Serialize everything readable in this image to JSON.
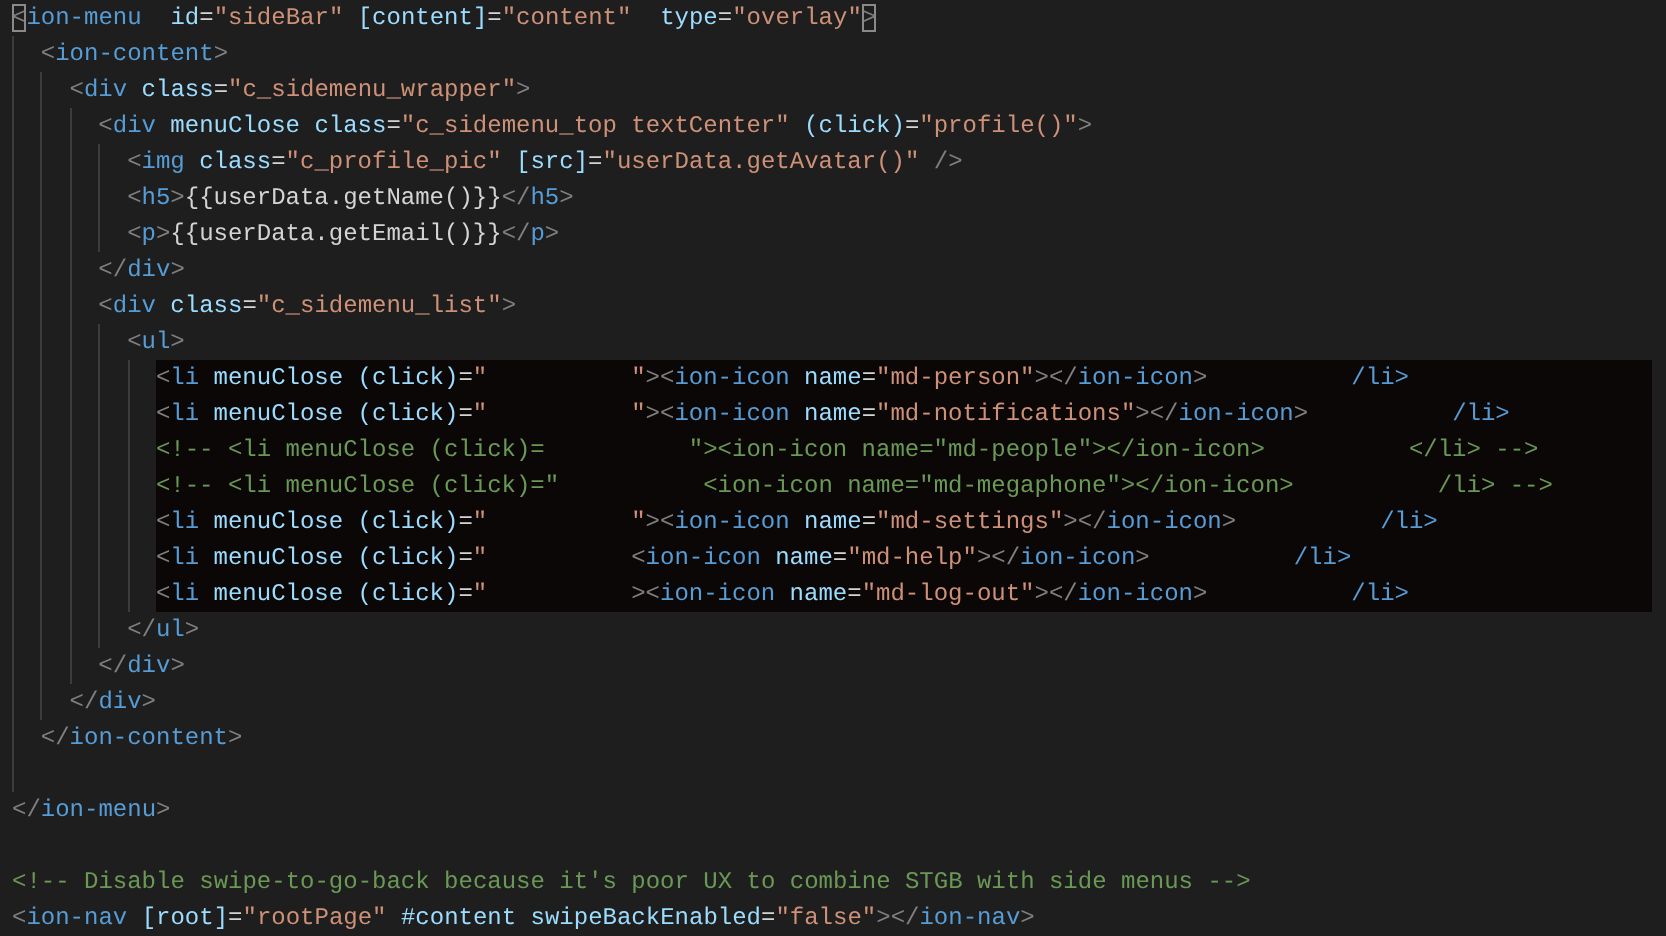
{
  "editor": {
    "lines": [
      {
        "segments": [
          {
            "kind": "match",
            "text": "<"
          },
          {
            "kind": "tag",
            "text": "ion-menu"
          },
          {
            "kind": "attr",
            "text": "  id"
          },
          {
            "kind": "op",
            "text": "="
          },
          {
            "kind": "str",
            "text": "\"sideBar\""
          },
          {
            "kind": "attr",
            "text": " [content]"
          },
          {
            "kind": "op",
            "text": "="
          },
          {
            "kind": "str",
            "text": "\"content\""
          },
          {
            "kind": "attr",
            "text": "  type"
          },
          {
            "kind": "op",
            "text": "="
          },
          {
            "kind": "str",
            "text": "\"overlay\""
          },
          {
            "kind": "match",
            "text": ">"
          }
        ],
        "children": [
          {
            "segments": [
              {
                "kind": "punct",
                "text": "<"
              },
              {
                "kind": "tag",
                "text": "ion-content"
              },
              {
                "kind": "punct",
                "text": ">"
              }
            ],
            "children": [
              {
                "segments": [
                  {
                    "kind": "punct",
                    "text": "<"
                  },
                  {
                    "kind": "tag",
                    "text": "div"
                  },
                  {
                    "kind": "attr",
                    "text": " class"
                  },
                  {
                    "kind": "op",
                    "text": "="
                  },
                  {
                    "kind": "str",
                    "text": "\"c_sidemenu_wrapper\""
                  },
                  {
                    "kind": "punct",
                    "text": ">"
                  }
                ],
                "children": [
                  {
                    "segments": [
                      {
                        "kind": "punct",
                        "text": "<"
                      },
                      {
                        "kind": "tag",
                        "text": "div"
                      },
                      {
                        "kind": "attr",
                        "text": " menuClose class"
                      },
                      {
                        "kind": "op",
                        "text": "="
                      },
                      {
                        "kind": "str",
                        "text": "\"c_sidemenu_top textCenter\""
                      },
                      {
                        "kind": "attr",
                        "text": " (click)"
                      },
                      {
                        "kind": "op",
                        "text": "="
                      },
                      {
                        "kind": "str",
                        "text": "\"profile()\""
                      },
                      {
                        "kind": "punct",
                        "text": ">"
                      }
                    ],
                    "children": [
                      {
                        "segments": [
                          {
                            "kind": "punct",
                            "text": "<"
                          },
                          {
                            "kind": "tag",
                            "text": "img"
                          },
                          {
                            "kind": "attr",
                            "text": " class"
                          },
                          {
                            "kind": "op",
                            "text": "="
                          },
                          {
                            "kind": "str",
                            "text": "\"c_profile_pic\""
                          },
                          {
                            "kind": "attr",
                            "text": " [src]"
                          },
                          {
                            "kind": "op",
                            "text": "="
                          },
                          {
                            "kind": "str",
                            "text": "\"userData.getAvatar()\""
                          },
                          {
                            "kind": "punct",
                            "text": " />"
                          }
                        ]
                      },
                      {
                        "segments": [
                          {
                            "kind": "punct",
                            "text": "<"
                          },
                          {
                            "kind": "tag",
                            "text": "h5"
                          },
                          {
                            "kind": "punct",
                            "text": ">"
                          },
                          {
                            "kind": "op",
                            "text": "{{userData.getName()}}"
                          },
                          {
                            "kind": "punct",
                            "text": "</"
                          },
                          {
                            "kind": "tag",
                            "text": "h5"
                          },
                          {
                            "kind": "punct",
                            "text": ">"
                          }
                        ]
                      },
                      {
                        "segments": [
                          {
                            "kind": "punct",
                            "text": "<"
                          },
                          {
                            "kind": "tag",
                            "text": "p"
                          },
                          {
                            "kind": "punct",
                            "text": ">"
                          },
                          {
                            "kind": "op",
                            "text": "{{userData.getEmail()}}"
                          },
                          {
                            "kind": "punct",
                            "text": "</"
                          },
                          {
                            "kind": "tag",
                            "text": "p"
                          },
                          {
                            "kind": "punct",
                            "text": ">"
                          }
                        ]
                      }
                    ]
                  },
                  {
                    "segments": [
                      {
                        "kind": "punct",
                        "text": "</"
                      },
                      {
                        "kind": "tag",
                        "text": "div"
                      },
                      {
                        "kind": "punct",
                        "text": ">"
                      }
                    ]
                  },
                  {
                    "segments": [
                      {
                        "kind": "punct",
                        "text": "<"
                      },
                      {
                        "kind": "tag",
                        "text": "div"
                      },
                      {
                        "kind": "attr",
                        "text": " class"
                      },
                      {
                        "kind": "op",
                        "text": "="
                      },
                      {
                        "kind": "str",
                        "text": "\"c_sidemenu_list\""
                      },
                      {
                        "kind": "punct",
                        "text": ">"
                      }
                    ],
                    "children": [
                      {
                        "segments": [
                          {
                            "kind": "punct",
                            "text": "<"
                          },
                          {
                            "kind": "tag",
                            "text": "ul"
                          },
                          {
                            "kind": "punct",
                            "text": ">"
                          }
                        ],
                        "children": [
                          {
                            "highlighted": true,
                            "segments": [
                              {
                                "kind": "punct",
                                "text": "<"
                              },
                              {
                                "kind": "tag",
                                "text": "li"
                              },
                              {
                                "kind": "attr",
                                "text": " menuClose (click)"
                              },
                              {
                                "kind": "op",
                                "text": "="
                              },
                              {
                                "kind": "str",
                                "text": "\""
                              },
                              {
                                "kind": "redacted"
                              },
                              {
                                "kind": "str",
                                "text": "\""
                              },
                              {
                                "kind": "punct",
                                "text": "><"
                              },
                              {
                                "kind": "tag",
                                "text": "ion-icon"
                              },
                              {
                                "kind": "attr",
                                "text": " name"
                              },
                              {
                                "kind": "op",
                                "text": "="
                              },
                              {
                                "kind": "str",
                                "text": "\"md-person\""
                              },
                              {
                                "kind": "punct",
                                "text": "></"
                              },
                              {
                                "kind": "tag",
                                "text": "ion-icon"
                              },
                              {
                                "kind": "punct",
                                "text": ">"
                              },
                              {
                                "kind": "redacted"
                              },
                              {
                                "kind": "tag",
                                "text": "/li>"
                              }
                            ]
                          },
                          {
                            "highlighted": true,
                            "segments": [
                              {
                                "kind": "punct",
                                "text": "<"
                              },
                              {
                                "kind": "tag",
                                "text": "li"
                              },
                              {
                                "kind": "attr",
                                "text": " menuClose (click)"
                              },
                              {
                                "kind": "op",
                                "text": "="
                              },
                              {
                                "kind": "str",
                                "text": "\""
                              },
                              {
                                "kind": "redacted"
                              },
                              {
                                "kind": "str",
                                "text": "\""
                              },
                              {
                                "kind": "punct",
                                "text": "><"
                              },
                              {
                                "kind": "tag",
                                "text": "ion-icon"
                              },
                              {
                                "kind": "attr",
                                "text": " name"
                              },
                              {
                                "kind": "op",
                                "text": "="
                              },
                              {
                                "kind": "str",
                                "text": "\"md-notifications\""
                              },
                              {
                                "kind": "punct",
                                "text": "></"
                              },
                              {
                                "kind": "tag",
                                "text": "ion-icon"
                              },
                              {
                                "kind": "punct",
                                "text": ">"
                              },
                              {
                                "kind": "redacted"
                              },
                              {
                                "kind": "tag",
                                "text": "/li>"
                              }
                            ]
                          },
                          {
                            "highlighted": true,
                            "segments": [
                              {
                                "kind": "comment",
                                "text": "<!-- <li menuClose (click)="
                              },
                              {
                                "kind": "redacted"
                              },
                              {
                                "kind": "comment",
                                "text": "\"><ion-icon name=\"md-people\"></ion-icon>"
                              },
                              {
                                "kind": "redacted"
                              },
                              {
                                "kind": "comment",
                                "text": "</li> -->"
                              }
                            ]
                          },
                          {
                            "highlighted": true,
                            "segments": [
                              {
                                "kind": "comment",
                                "text": "<!-- <li menuClose (click)=\""
                              },
                              {
                                "kind": "redacted"
                              },
                              {
                                "kind": "comment",
                                "text": "<ion-icon name=\"md-megaphone\"></ion-icon>"
                              },
                              {
                                "kind": "redacted"
                              },
                              {
                                "kind": "comment",
                                "text": "/li> -->"
                              }
                            ]
                          },
                          {
                            "highlighted": true,
                            "segments": [
                              {
                                "kind": "punct",
                                "text": "<"
                              },
                              {
                                "kind": "tag",
                                "text": "li"
                              },
                              {
                                "kind": "attr",
                                "text": " menuClose (click)"
                              },
                              {
                                "kind": "op",
                                "text": "="
                              },
                              {
                                "kind": "str",
                                "text": "\""
                              },
                              {
                                "kind": "redacted"
                              },
                              {
                                "kind": "str",
                                "text": "\""
                              },
                              {
                                "kind": "punct",
                                "text": "><"
                              },
                              {
                                "kind": "tag",
                                "text": "ion-icon"
                              },
                              {
                                "kind": "attr",
                                "text": " name"
                              },
                              {
                                "kind": "op",
                                "text": "="
                              },
                              {
                                "kind": "str",
                                "text": "\"md-settings\""
                              },
                              {
                                "kind": "punct",
                                "text": "></"
                              },
                              {
                                "kind": "tag",
                                "text": "ion-icon"
                              },
                              {
                                "kind": "punct",
                                "text": ">"
                              },
                              {
                                "kind": "redacted"
                              },
                              {
                                "kind": "tag",
                                "text": "/li>"
                              }
                            ]
                          },
                          {
                            "highlighted": true,
                            "segments": [
                              {
                                "kind": "punct",
                                "text": "<"
                              },
                              {
                                "kind": "tag",
                                "text": "li"
                              },
                              {
                                "kind": "attr",
                                "text": " menuClose (click)"
                              },
                              {
                                "kind": "op",
                                "text": "="
                              },
                              {
                                "kind": "str",
                                "text": "\""
                              },
                              {
                                "kind": "redacted"
                              },
                              {
                                "kind": "punct",
                                "text": "<"
                              },
                              {
                                "kind": "tag",
                                "text": "ion-icon"
                              },
                              {
                                "kind": "attr",
                                "text": " name"
                              },
                              {
                                "kind": "op",
                                "text": "="
                              },
                              {
                                "kind": "str",
                                "text": "\"md-help\""
                              },
                              {
                                "kind": "punct",
                                "text": "></"
                              },
                              {
                                "kind": "tag",
                                "text": "ion-icon"
                              },
                              {
                                "kind": "punct",
                                "text": ">"
                              },
                              {
                                "kind": "redacted"
                              },
                              {
                                "kind": "tag",
                                "text": "/li>"
                              }
                            ]
                          },
                          {
                            "highlighted": true,
                            "segments": [
                              {
                                "kind": "punct",
                                "text": "<"
                              },
                              {
                                "kind": "tag",
                                "text": "li"
                              },
                              {
                                "kind": "attr",
                                "text": " menuClose (click)"
                              },
                              {
                                "kind": "op",
                                "text": "="
                              },
                              {
                                "kind": "str",
                                "text": "\""
                              },
                              {
                                "kind": "redacted"
                              },
                              {
                                "kind": "punct",
                                "text": "><"
                              },
                              {
                                "kind": "tag",
                                "text": "ion-icon"
                              },
                              {
                                "kind": "attr",
                                "text": " name"
                              },
                              {
                                "kind": "op",
                                "text": "="
                              },
                              {
                                "kind": "str",
                                "text": "\"md-log-out\""
                              },
                              {
                                "kind": "punct",
                                "text": "></"
                              },
                              {
                                "kind": "tag",
                                "text": "ion-icon"
                              },
                              {
                                "kind": "punct",
                                "text": ">"
                              },
                              {
                                "kind": "redacted"
                              },
                              {
                                "kind": "tag",
                                "text": "/li>"
                              }
                            ]
                          }
                        ]
                      },
                      {
                        "segments": [
                          {
                            "kind": "punct",
                            "text": "</"
                          },
                          {
                            "kind": "tag",
                            "text": "ul"
                          },
                          {
                            "kind": "punct",
                            "text": ">"
                          }
                        ]
                      }
                    ]
                  },
                  {
                    "segments": [
                      {
                        "kind": "punct",
                        "text": "</"
                      },
                      {
                        "kind": "tag",
                        "text": "div"
                      },
                      {
                        "kind": "punct",
                        "text": ">"
                      }
                    ]
                  }
                ]
              },
              {
                "segments": [
                  {
                    "kind": "punct",
                    "text": "</"
                  },
                  {
                    "kind": "tag",
                    "text": "div"
                  },
                  {
                    "kind": "punct",
                    "text": ">"
                  }
                ]
              }
            ]
          },
          {
            "segments": [
              {
                "kind": "punct",
                "text": "</"
              },
              {
                "kind": "tag",
                "text": "ion-content"
              },
              {
                "kind": "punct",
                "text": ">"
              }
            ]
          }
        ]
      },
      {
        "segments": [
          {
            "kind": "punct",
            "text": "</"
          },
          {
            "kind": "tag",
            "text": "ion-menu"
          },
          {
            "kind": "punct",
            "text": ">"
          }
        ]
      }
    ],
    "footer": [
      {
        "segments": [
          {
            "kind": "comment",
            "text": "<!-- Disable swipe-to-go-back because it's poor UX to combine STGB with side menus -->"
          }
        ]
      },
      {
        "segments": [
          {
            "kind": "punct",
            "text": "<"
          },
          {
            "kind": "tag",
            "text": "ion-nav"
          },
          {
            "kind": "attr",
            "text": " [root]"
          },
          {
            "kind": "op",
            "text": "="
          },
          {
            "kind": "str",
            "text": "\"rootPage\""
          },
          {
            "kind": "attr",
            "text": " #content swipeBackEnabled"
          },
          {
            "kind": "op",
            "text": "="
          },
          {
            "kind": "str",
            "text": "\"false\""
          },
          {
            "kind": "punct",
            "text": "></"
          },
          {
            "kind": "tag",
            "text": "ion-nav"
          },
          {
            "kind": "punct",
            "text": ">"
          }
        ]
      }
    ]
  }
}
